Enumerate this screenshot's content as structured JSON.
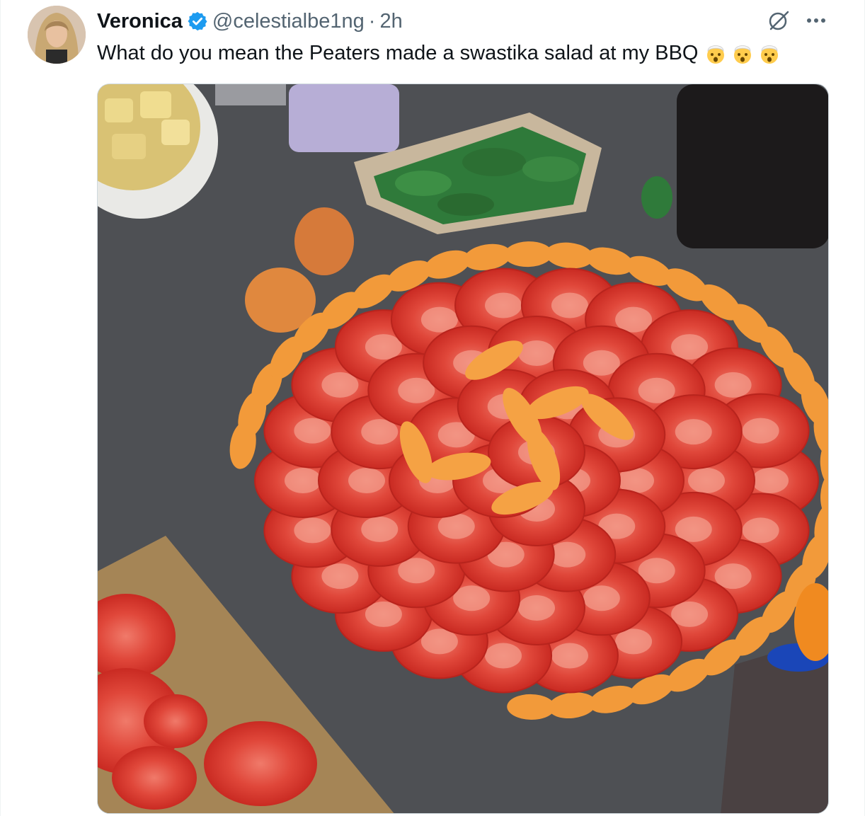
{
  "tweet": {
    "author_name": "Veronica",
    "author_handle": "@celestialbe1ng",
    "separator": "·",
    "timestamp": "2h",
    "text": "What do you mean the Peaters made a swastika salad at my BBQ",
    "emojis": [
      "exploding-head",
      "exploding-head",
      "exploding-head"
    ]
  },
  "icons": {
    "verified": "verified-badge-icon",
    "grok": "grok-icon",
    "more": "more-icon"
  },
  "colors": {
    "verified": "#1d9bf0",
    "secondary_text": "#536471",
    "primary_text": "#0f1419"
  }
}
